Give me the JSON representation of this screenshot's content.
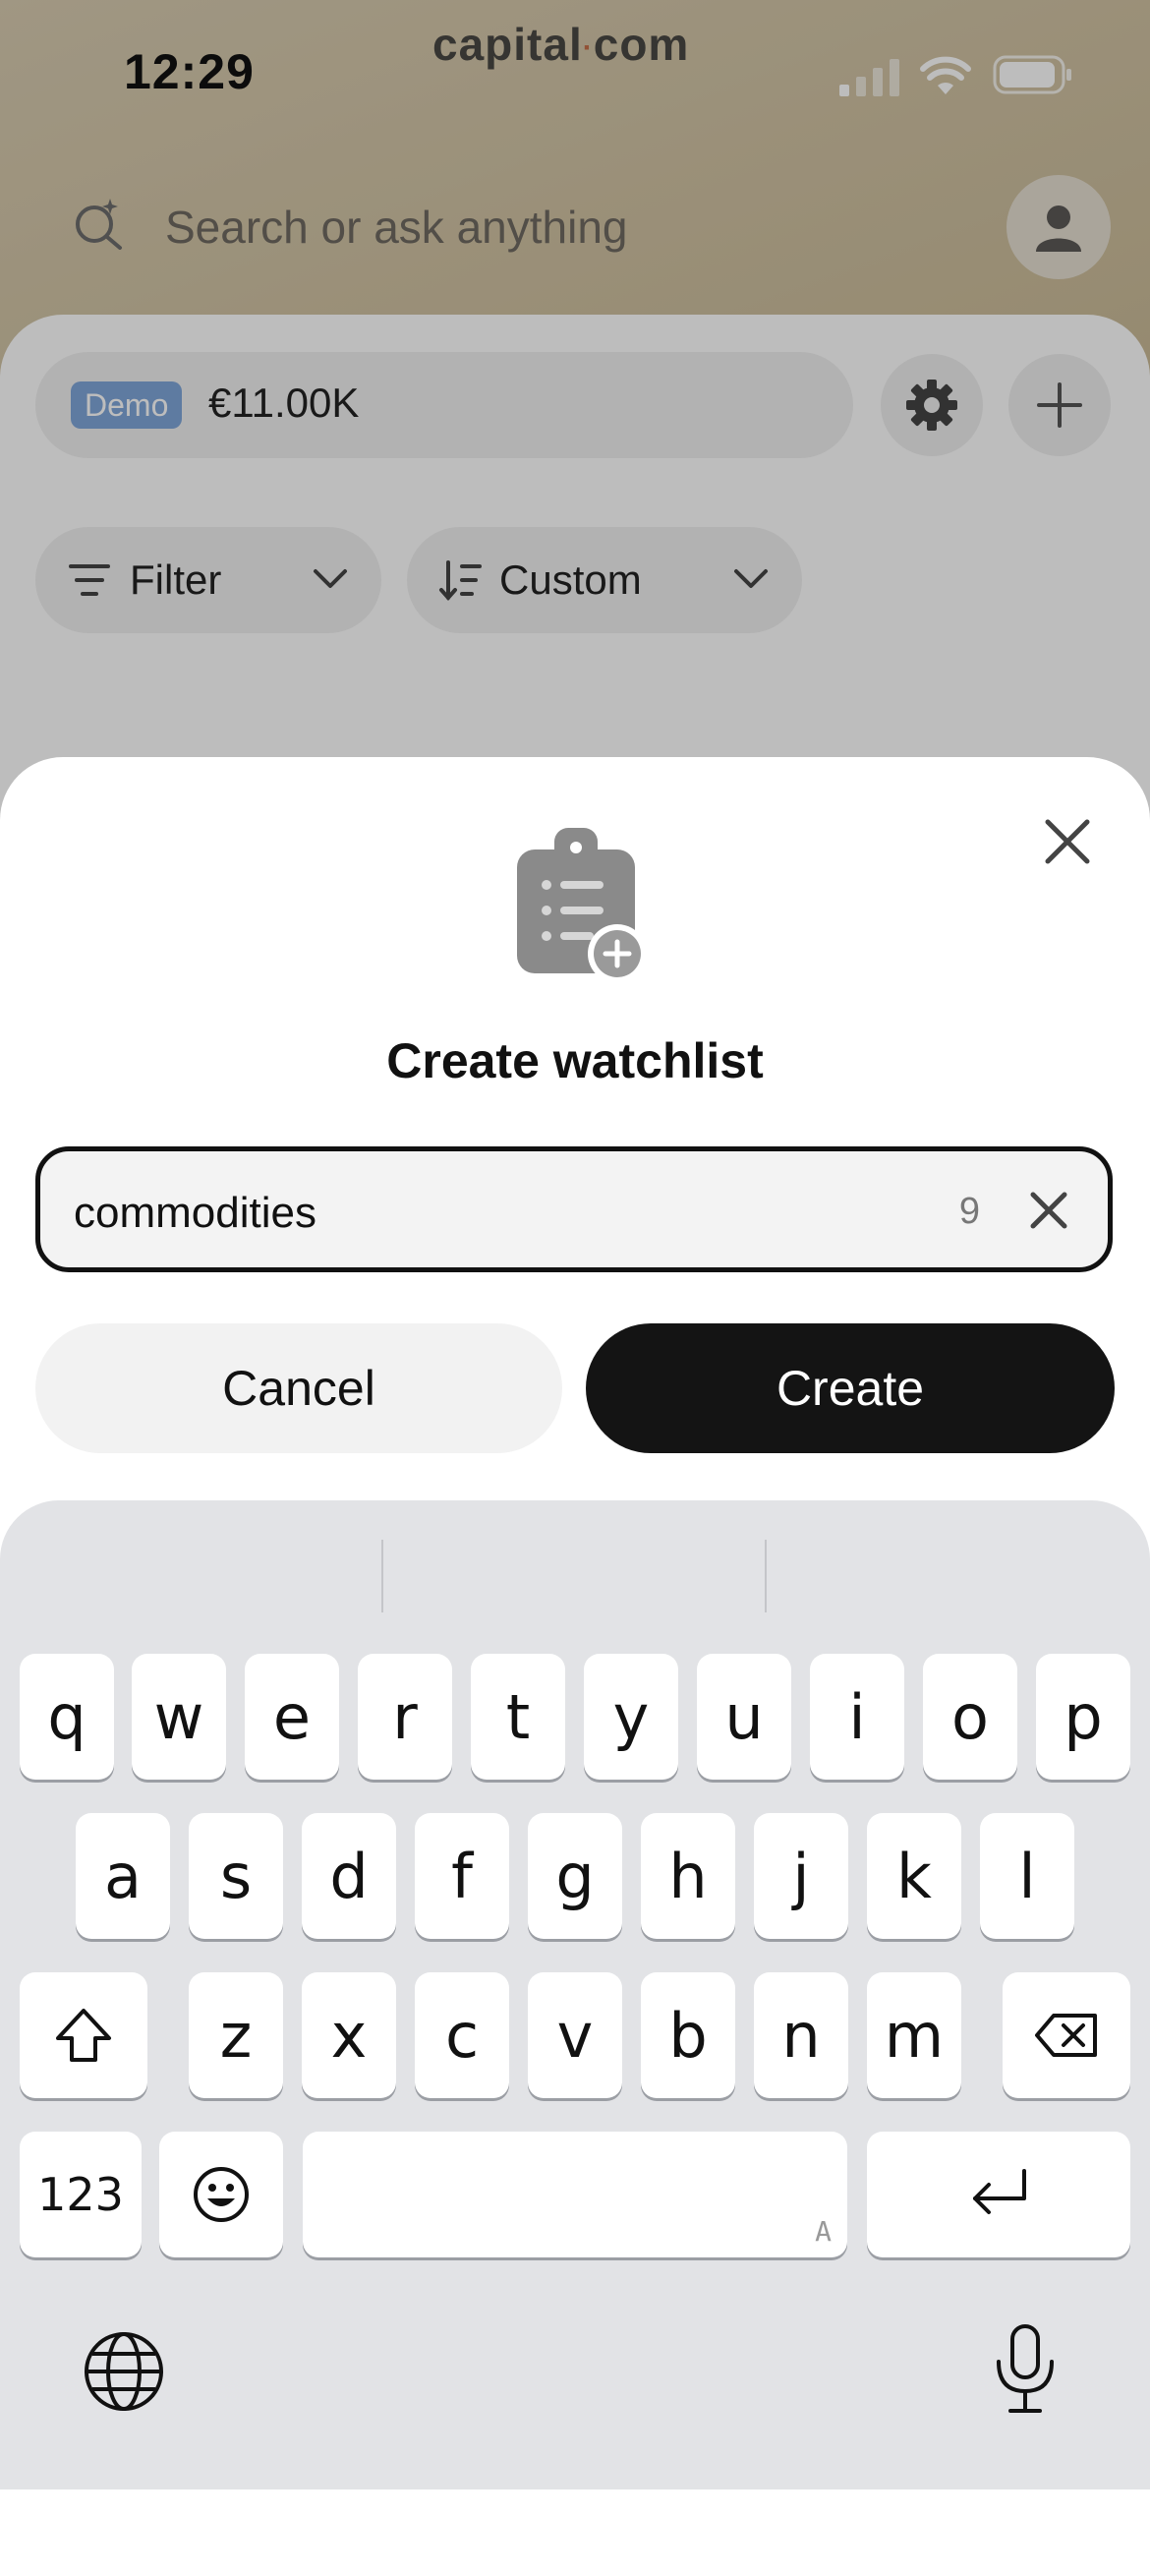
{
  "status_bar": {
    "time": "12:29"
  },
  "app": {
    "brand": {
      "left": "capital",
      "dot": "·",
      "right": "com"
    },
    "search": {
      "placeholder": "Search or ask anything"
    },
    "account": {
      "badge": "Demo",
      "balance": "€11.00K"
    },
    "filters": {
      "filter_label": "Filter",
      "sort_label": "Custom"
    }
  },
  "sheet": {
    "title": "Create watchlist",
    "input": {
      "value": "commodities",
      "char_count": "9"
    },
    "cancel_label": "Cancel",
    "create_label": "Create"
  },
  "keyboard": {
    "row1": [
      "q",
      "w",
      "e",
      "r",
      "t",
      "y",
      "u",
      "i",
      "o",
      "p"
    ],
    "row2": [
      "a",
      "s",
      "d",
      "f",
      "g",
      "h",
      "j",
      "k",
      "l"
    ],
    "row3": [
      "z",
      "x",
      "c",
      "v",
      "b",
      "n",
      "m"
    ],
    "numbers_label": "123",
    "space_hint": "A"
  },
  "colors": {
    "demo_badge": "#7fa6d9",
    "create_button": "#141414",
    "brand_dot": "#c46e4a"
  }
}
